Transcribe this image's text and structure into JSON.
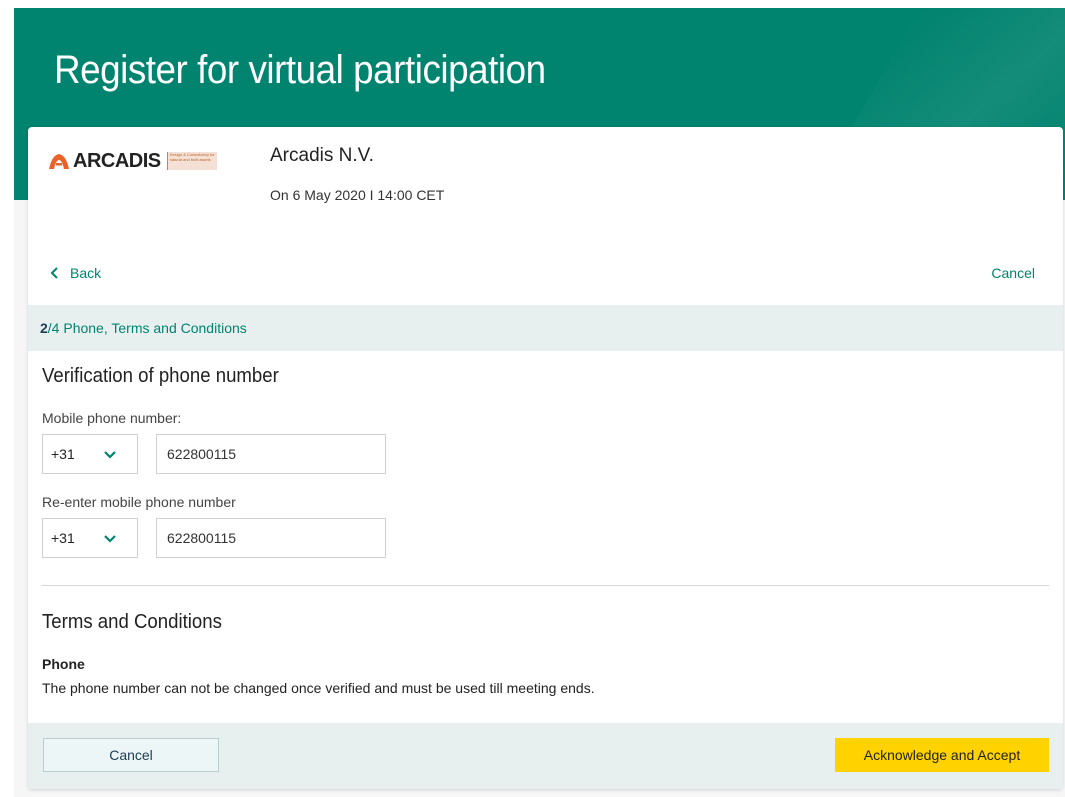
{
  "page": {
    "title": "Register for virtual participation"
  },
  "header": {
    "logo_text": "ARCADIS",
    "logo_tagline": "Design & Consultancy for natural and built assets",
    "company_name": "Arcadis N.V.",
    "meeting_date": "On 6 May 2020 I 14:00 CET"
  },
  "nav": {
    "back_label": "Back",
    "cancel_label": "Cancel"
  },
  "step": {
    "current": "2",
    "rest": "/4 Phone, Terms and Conditions"
  },
  "verification": {
    "title": "Verification of phone number",
    "mobile_label": "Mobile phone number:",
    "mobile_country_code": "+31",
    "mobile_value": "622800115",
    "reenter_label": "Re-enter mobile phone number",
    "reenter_country_code": "+31",
    "reenter_value": "622800115"
  },
  "terms": {
    "title": "Terms and Conditions",
    "phone_heading": "Phone",
    "phone_text": "The phone number can not be changed once verified and must be used till meeting ends."
  },
  "footer": {
    "cancel_label": "Cancel",
    "accept_label": "Acknowledge and Accept"
  },
  "colors": {
    "brand": "#00836f",
    "accent": "#ffd200",
    "logo_orange": "#e8642a"
  }
}
